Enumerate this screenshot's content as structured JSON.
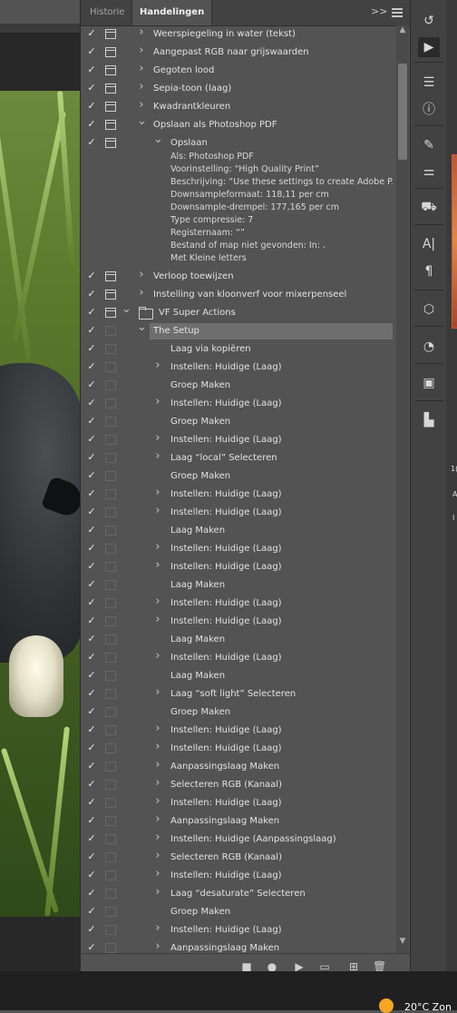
{
  "panel": {
    "tabs": [
      {
        "label": "Historie",
        "active": false
      },
      {
        "label": "Handelingen",
        "active": true
      }
    ],
    "expand_icon": "double-chevron-right-icon",
    "menu_icon": "hamburger-menu-icon"
  },
  "actions": [
    {
      "label": "Weerspiegeling in water (tekst)",
      "check": true,
      "dialog": true,
      "arrow": "collapsed",
      "indent": 0
    },
    {
      "label": "Aangepast RGB naar grijswaarden",
      "check": true,
      "dialog": true,
      "arrow": "collapsed",
      "indent": 0
    },
    {
      "label": "Gegoten lood",
      "check": true,
      "dialog": true,
      "arrow": "collapsed",
      "indent": 0
    },
    {
      "label": "Sepia-toon (laag)",
      "check": true,
      "dialog": true,
      "arrow": "collapsed",
      "indent": 0
    },
    {
      "label": "Kwadrantkleuren",
      "check": true,
      "dialog": true,
      "arrow": "collapsed",
      "indent": 0
    },
    {
      "label": "Opslaan als Photoshop PDF",
      "check": true,
      "dialog": true,
      "arrow": "expanded",
      "indent": 0
    },
    {
      "label": "Opslaan",
      "check": true,
      "dialog": true,
      "arrow": "expanded",
      "indent": 1,
      "details": [
        "Als: Photoshop PDF",
        "Voorinstelling: “High Quality Print”",
        "Beschrijving: “Use these settings to create Adobe P...",
        "Downsampleformaat: 118,11 per cm",
        "Downsample-drempel: 177,165 per cm",
        "Type compressie: 7",
        "Registernaam: “”",
        "Bestand of map niet gevonden: In: .",
        "Met Kleine letters"
      ]
    },
    {
      "label": "Verloop toewijzen",
      "check": true,
      "dialog": true,
      "arrow": "collapsed",
      "indent": 0
    },
    {
      "label": "Instelling van kloonverf voor mixerpenseel",
      "check": true,
      "dialog": true,
      "arrow": "collapsed",
      "indent": 0
    }
  ],
  "set": {
    "label": "VF Super Actions",
    "check": true,
    "arrow": "expanded"
  },
  "setup": {
    "label": "The Setup",
    "check": true,
    "arrow": "expanded"
  },
  "steps": [
    {
      "label": "Laag via kopiëren",
      "arrow": false
    },
    {
      "label": "Instellen: Huidige (Laag)",
      "arrow": true
    },
    {
      "label": "Groep Maken",
      "arrow": false
    },
    {
      "label": "Instellen: Huidige (Laag)",
      "arrow": true
    },
    {
      "label": "Groep Maken",
      "arrow": false
    },
    {
      "label": "Instellen: Huidige (Laag)",
      "arrow": true
    },
    {
      "label": "Laag “local” Selecteren",
      "arrow": true
    },
    {
      "label": "Groep Maken",
      "arrow": false
    },
    {
      "label": "Instellen: Huidige (Laag)",
      "arrow": true
    },
    {
      "label": "Instellen: Huidige (Laag)",
      "arrow": true
    },
    {
      "label": "Laag Maken",
      "arrow": false
    },
    {
      "label": "Instellen: Huidige (Laag)",
      "arrow": true
    },
    {
      "label": "Instellen: Huidige (Laag)",
      "arrow": true
    },
    {
      "label": "Laag Maken",
      "arrow": false
    },
    {
      "label": "Instellen: Huidige (Laag)",
      "arrow": true
    },
    {
      "label": "Instellen: Huidige (Laag)",
      "arrow": true
    },
    {
      "label": "Laag Maken",
      "arrow": false
    },
    {
      "label": "Instellen: Huidige (Laag)",
      "arrow": true
    },
    {
      "label": "Laag Maken",
      "arrow": false
    },
    {
      "label": "Laag “soft light” Selecteren",
      "arrow": true
    },
    {
      "label": "Groep Maken",
      "arrow": false
    },
    {
      "label": "Instellen: Huidige (Laag)",
      "arrow": true
    },
    {
      "label": "Instellen: Huidige (Laag)",
      "arrow": true
    },
    {
      "label": "Aanpassingslaag Maken",
      "arrow": true
    },
    {
      "label": "Selecteren RGB (Kanaal)",
      "arrow": true
    },
    {
      "label": "Instellen: Huidige (Laag)",
      "arrow": true
    },
    {
      "label": "Aanpassingslaag Maken",
      "arrow": true
    },
    {
      "label": "Instellen: Huidige (Aanpassingslaag)",
      "arrow": true
    },
    {
      "label": "Selecteren RGB (Kanaal)",
      "arrow": true
    },
    {
      "label": "Instellen: Huidige (Laag)",
      "arrow": true
    },
    {
      "label": "Laag “desaturate” Selecteren",
      "arrow": true
    },
    {
      "label": "Groep Maken",
      "arrow": false
    },
    {
      "label": "Instellen: Huidige (Laag)",
      "arrow": true
    },
    {
      "label": "Aanpassingslaag Maken",
      "arrow": true
    }
  ],
  "bottom_bar": [
    {
      "name": "stop-icon",
      "glyph": "■"
    },
    {
      "name": "record-icon",
      "glyph": "●"
    },
    {
      "name": "play-icon",
      "glyph": "▶"
    },
    {
      "name": "new-set-folder-icon",
      "glyph": "▭"
    },
    {
      "name": "new-action-icon",
      "glyph": "⊞"
    },
    {
      "name": "trash-icon",
      "glyph": "🗑"
    }
  ],
  "tools": [
    {
      "name": "history-brush-icon",
      "glyph": "↺"
    },
    {
      "name": "play-actions-icon",
      "glyph": "▶",
      "active": true
    },
    {
      "name": "adjustments-icon",
      "glyph": "☰"
    },
    {
      "name": "info-icon",
      "glyph": "ⓘ"
    },
    {
      "name": "brush-settings-icon",
      "glyph": "✎"
    },
    {
      "name": "brushes-icon",
      "glyph": "⚌"
    },
    {
      "name": "clone-source-icon",
      "glyph": "⛟"
    },
    {
      "name": "character-icon",
      "glyph": "A|"
    },
    {
      "name": "paragraph-icon",
      "glyph": "¶"
    },
    {
      "name": "3d-icon",
      "glyph": "⬡"
    },
    {
      "name": "timeline-icon",
      "glyph": "◔"
    },
    {
      "name": "gradient-icon",
      "glyph": "▣"
    },
    {
      "name": "properties-icon",
      "glyph": "▙"
    }
  ],
  "right_strip": {
    "number": "1(",
    "a": "A",
    "b": "I"
  },
  "taskbar": {
    "weather": "20°C  Zon"
  },
  "colors": {
    "panel": "#535353",
    "tab_bar": "#424242",
    "selected_row": "#6e6e6e",
    "weather": "#f5a623"
  }
}
